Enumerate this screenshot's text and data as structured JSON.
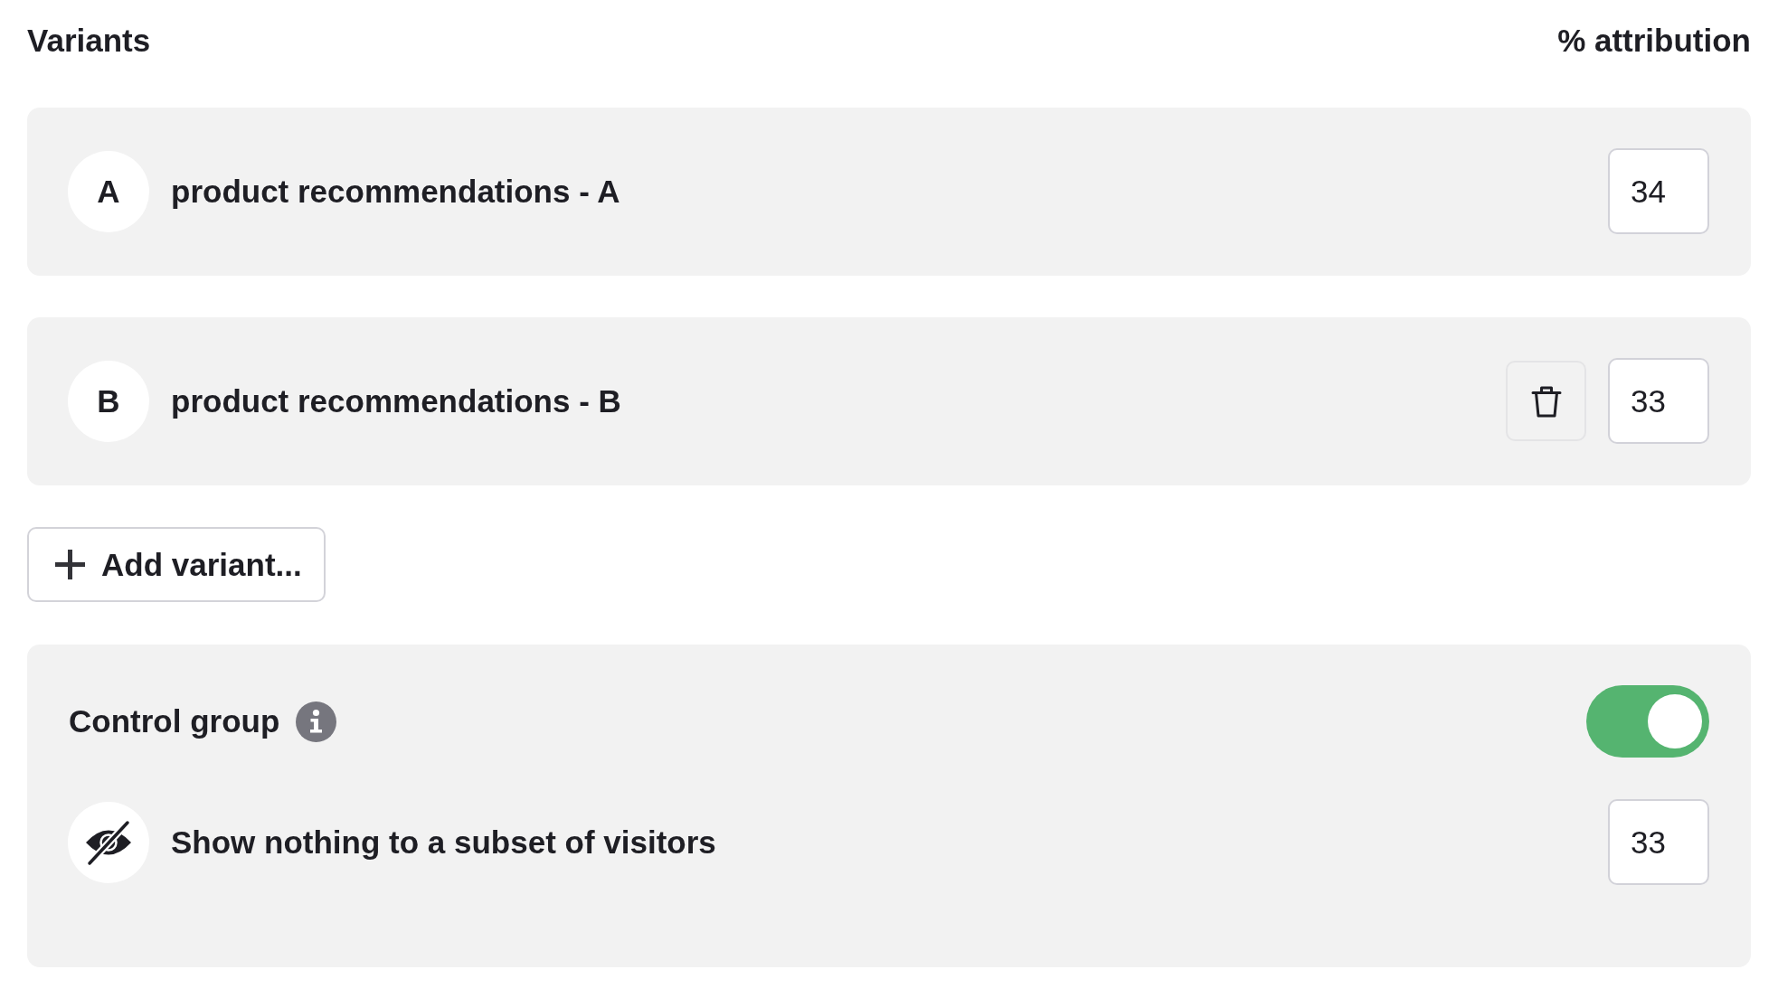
{
  "header": {
    "title": "Variants",
    "attribution_label": "% attribution"
  },
  "variants": [
    {
      "letter": "A",
      "name": "product recommendations - A",
      "attribution": "34",
      "deletable": false
    },
    {
      "letter": "B",
      "name": "product recommendations - B",
      "attribution": "33",
      "deletable": true
    }
  ],
  "add_variant_button": {
    "label": "Add variant..."
  },
  "control_group": {
    "title": "Control group",
    "on": true,
    "option": {
      "label": "Show nothing to a subset of visitors",
      "attribution": "33"
    }
  }
}
